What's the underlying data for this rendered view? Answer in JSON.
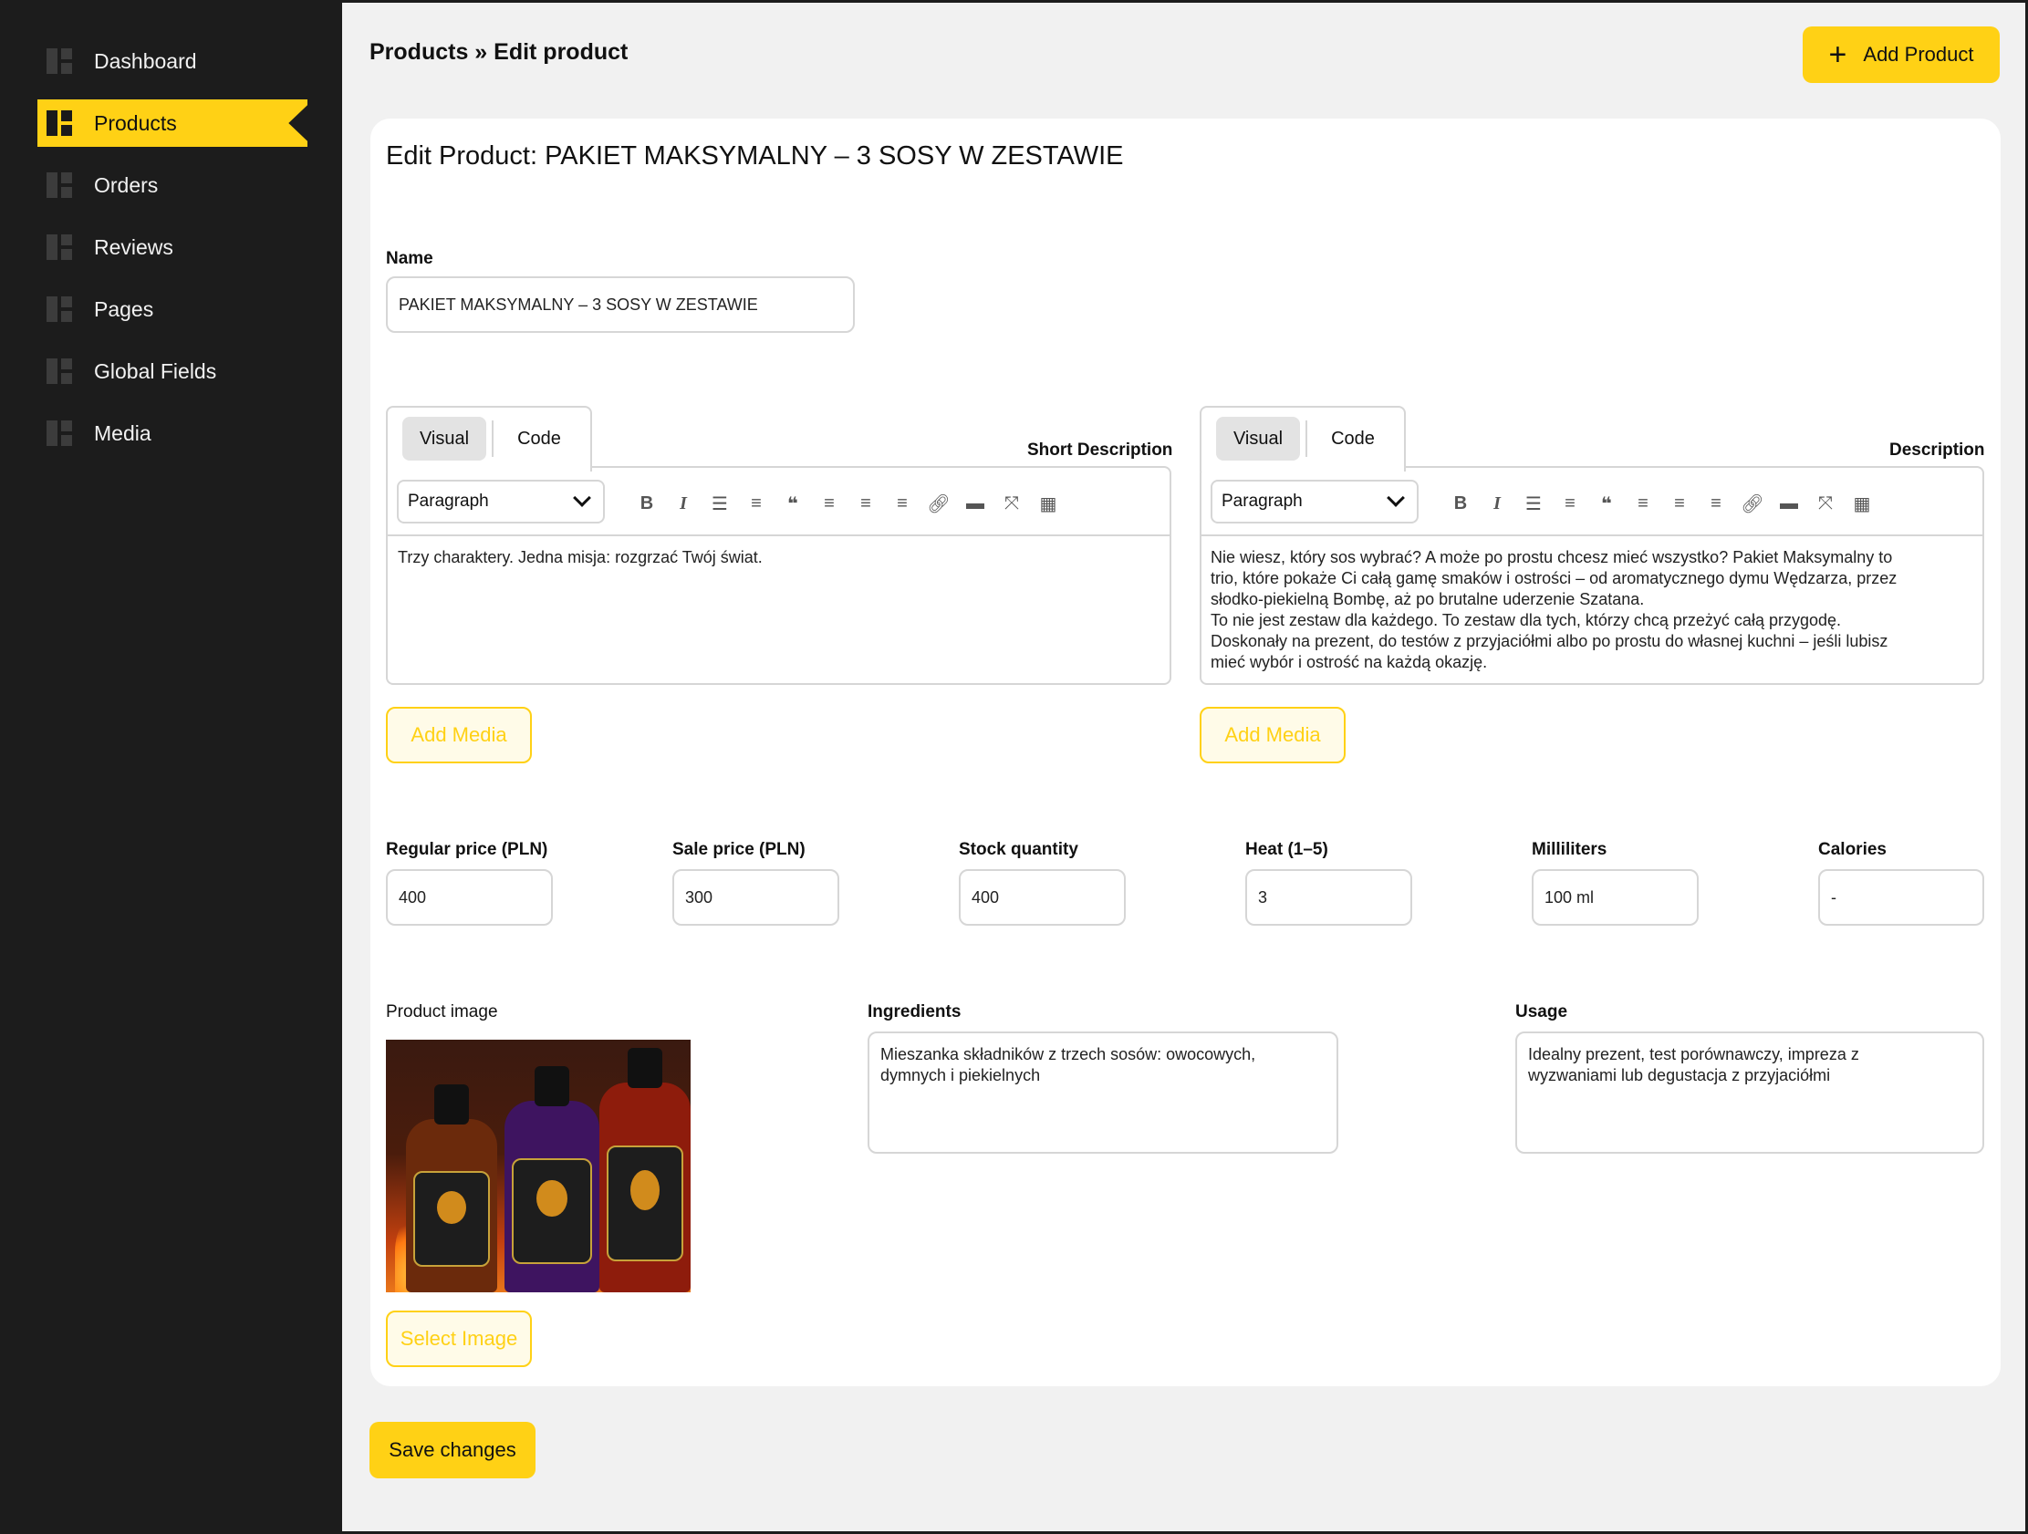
{
  "sidebar": {
    "items": [
      {
        "label": "Dashboard"
      },
      {
        "label": "Products"
      },
      {
        "label": "Orders"
      },
      {
        "label": "Reviews"
      },
      {
        "label": "Pages"
      },
      {
        "label": "Global Fields"
      },
      {
        "label": "Media"
      }
    ],
    "active": "Products"
  },
  "header": {
    "breadcrumb": "Products » Edit product",
    "add_button_label": "Add Product"
  },
  "card": {
    "title": "Edit Product: PAKIET MAKSYMALNY – 3 SOSY W ZESTAWIE"
  },
  "name_field": {
    "label": "Name",
    "value": "PAKIET MAKSYMALNY – 3 SOSY W ZESTAWIE"
  },
  "short_description": {
    "label": "Short Description",
    "tab_visual": "Visual",
    "tab_code": "Code",
    "format": "Paragraph",
    "content": "Trzy charaktery. Jedna misja: rozgrzać Twój świat.",
    "add_media_label": "Add Media"
  },
  "description": {
    "label": "Description",
    "tab_visual": "Visual",
    "tab_code": "Code",
    "format": "Paragraph",
    "lines": [
      "Nie wiesz, który sos wybrać? A może po prostu chcesz mieć wszystko? Pakiet Maksymalny to",
      "trio, które pokaże Ci całą gamę smaków i ostrości – od aromatycznego dymu Wędzarza, przez",
      "słodko-piekielną Bombę, aż po brutalne uderzenie Szatana.",
      "To nie jest zestaw dla każdego. To zestaw dla tych, którzy chcą przeżyć całą przygodę.",
      "Doskonały na prezent, do testów z przyjaciółmi albo po prostu do własnej kuchni – jeśli lubisz",
      "mieć wybór i ostrość na każdą okazję."
    ],
    "add_media_label": "Add Media"
  },
  "toolbar": {
    "icons": [
      "bold-icon",
      "italic-icon",
      "bullet-list-icon",
      "numbered-list-icon",
      "blockquote-icon",
      "align-left-icon",
      "align-center-icon",
      "align-right-icon",
      "link-icon",
      "horizontal-rule-icon",
      "fullscreen-icon",
      "keyboard-icon"
    ]
  },
  "fields": {
    "regular_price": {
      "label": "Regular price (PLN)",
      "value": "400"
    },
    "sale_price": {
      "label": "Sale price (PLN)",
      "value": "300"
    },
    "stock": {
      "label": "Stock quantity",
      "value": "400"
    },
    "heat": {
      "label": "Heat (1–5)",
      "value": "3"
    },
    "milliliters": {
      "label": "Milliliters",
      "value": "100 ml"
    },
    "calories": {
      "label": "Calories",
      "value": "-"
    }
  },
  "product_image": {
    "label": "Product image",
    "select_label": "Select Image"
  },
  "ingredients": {
    "label": "Ingredients",
    "lines": [
      "Mieszanka składników z trzech sosów: owocowych,",
      "dymnych i piekielnych"
    ]
  },
  "usage": {
    "label": "Usage",
    "lines": [
      "Idealny prezent, test porównawczy, impreza z",
      "wyzwaniami lub degustacja z przyjaciółmi"
    ]
  },
  "save_label": "Save changes",
  "colors": {
    "accent": "#ffd115",
    "sidebar_bg": "#1c1c1c",
    "page_bg": "#f1f1f1"
  }
}
